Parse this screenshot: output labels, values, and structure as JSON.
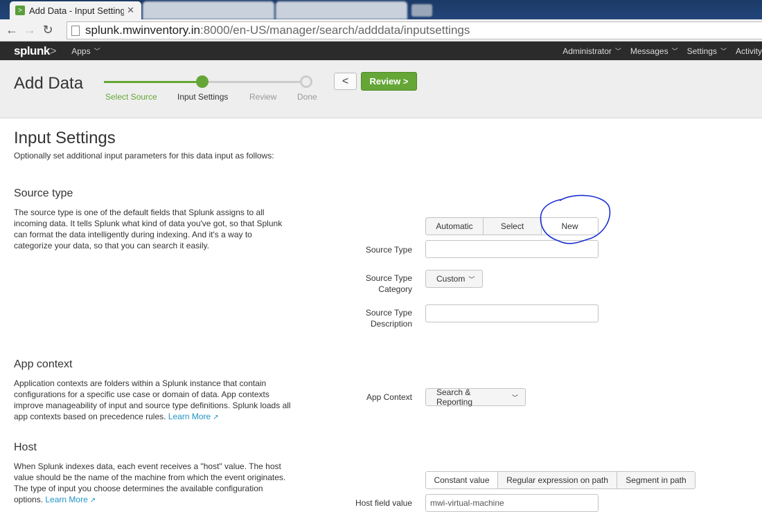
{
  "browser": {
    "active_tab_title": "Add Data - Input Settings",
    "url_host": "splunk.mwinventory.in",
    "url_rest": ":8000/en-US/manager/search/adddata/inputsettings",
    "favicon_glyph": ">"
  },
  "splunk_nav": {
    "logo": "splunk",
    "logo_suffix": ">",
    "apps_label": "Apps",
    "right_items": [
      "Administrator",
      "Messages",
      "Settings",
      "Activity"
    ]
  },
  "wizard": {
    "title": "Add Data",
    "steps": [
      {
        "label": "Select Source",
        "state": "done"
      },
      {
        "label": "Input Settings",
        "state": "current"
      },
      {
        "label": "Review",
        "state": "todo"
      },
      {
        "label": "Done",
        "state": "todo"
      }
    ],
    "back_glyph": "<",
    "review_label": "Review >"
  },
  "page": {
    "title": "Input Settings",
    "subtitle": "Optionally set additional input parameters for this data input as follows:"
  },
  "source_type": {
    "title": "Source type",
    "description": "The source type is one of the default fields that Splunk assigns to all incoming data. It tells Splunk what kind of data you've got, so that Splunk can format the data intelligently during indexing. And it's a way to categorize your data, so that you can search it easily.",
    "modes": [
      "Automatic",
      "Select",
      "New"
    ],
    "selected_mode": "New",
    "source_type_label": "Source Type",
    "source_type_value": "",
    "category_label_1": "Source Type",
    "category_label_2": "Category",
    "category_value": "Custom",
    "description_label_1": "Source Type",
    "description_label_2": "Description",
    "description_value": ""
  },
  "app_context": {
    "title": "App context",
    "description": "Application contexts are folders within a Splunk instance that contain configurations for a specific use case or domain of data. App contexts improve manageability of input and source type definitions. Splunk loads all app contexts based on precedence rules.",
    "learn_more": "Learn More",
    "label": "App Context",
    "value": "Search & Reporting"
  },
  "host": {
    "title": "Host",
    "description": "When Splunk indexes data, each event receives a \"host\" value. The host value should be the name of the machine from which the event originates. The type of input you choose determines the available configuration options.",
    "learn_more": "Learn More",
    "modes": [
      "Constant value",
      "Regular expression on path",
      "Segment in path"
    ],
    "selected_mode": "Constant value",
    "field_label": "Host field value",
    "field_value": "mwi-virtual-machine"
  },
  "annotation_color": "#1a2fd0",
  "accent_color": "#65a637"
}
